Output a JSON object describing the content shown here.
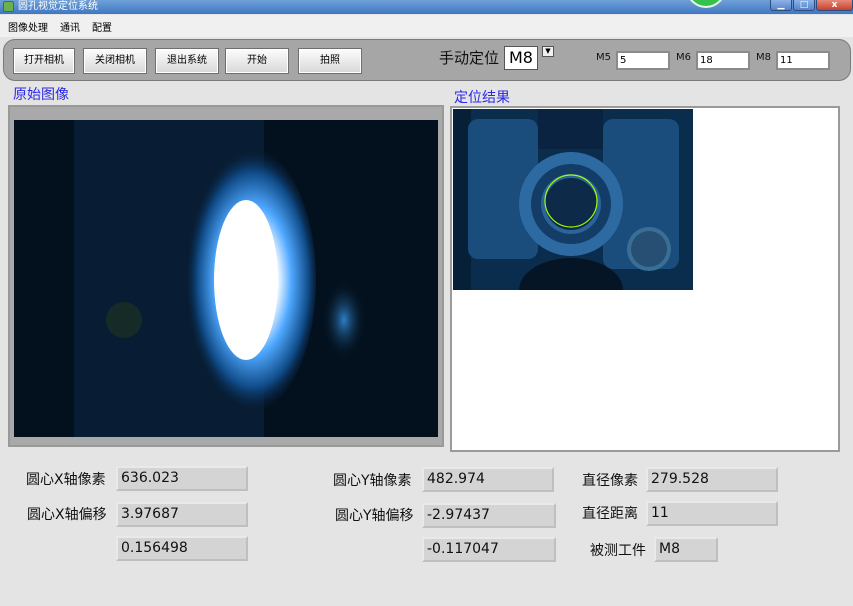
{
  "window": {
    "title": "圆孔视觉定位系统",
    "icons": {
      "app": "app-icon",
      "minimize": "minimize-icon",
      "maximize": "maximize-icon",
      "close": "close-icon"
    },
    "controls": {
      "minimize": "▁",
      "maximize": "□",
      "close": "x"
    }
  },
  "menu": {
    "items": [
      "图像处理",
      "通讯",
      "配置"
    ]
  },
  "toolbar": {
    "buttons": [
      "打开相机",
      "关闭相机",
      "退出系统",
      "开始",
      "拍照"
    ],
    "manual_label": "手动定位",
    "manual_value": "M8",
    "dropdown_icon": "chevron-down-icon",
    "dropdown_glyph": "▼",
    "fields": [
      {
        "label": "M5",
        "value": "5"
      },
      {
        "label": "M6",
        "value": "18"
      },
      {
        "label": "M8",
        "value": "11"
      }
    ]
  },
  "panels": {
    "original_label": "原始图像",
    "result_label": "定位结果"
  },
  "results": {
    "x_pixel_label": "圆心X轴像素",
    "x_pixel": "636.023",
    "x_offset_label": "圆心X轴偏移",
    "x_offset": "3.97687",
    "x_extra": "0.156498",
    "y_pixel_label": "圆心Y轴像素",
    "y_pixel": "482.974",
    "y_offset_label": "圆心Y轴偏移",
    "y_offset": "-2.97437",
    "y_extra": "-0.117047",
    "dia_pixel_label": "直径像素",
    "dia_pixel": "279.528",
    "dia_dist_label": "直径距离",
    "dia_dist": "11",
    "part_label": "被测工件",
    "part_value": "M8"
  },
  "colors": {
    "accent_label": "#2b28e8",
    "circle_overlay": "#a6ff00",
    "status_green": "#34c24a"
  }
}
